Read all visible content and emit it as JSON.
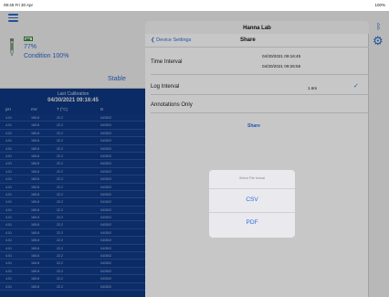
{
  "status_bar": {
    "time": "09:45 Fri 30 Apr",
    "battery": "100%"
  },
  "probe": {
    "battery_pct": "77%",
    "condition": "Condition 100%",
    "state": "Stable"
  },
  "calibration": {
    "label": "Last Calibration",
    "date": "04/30/2021 09:16:45"
  },
  "table": {
    "headers": [
      "pH",
      "mV",
      "T (°C)",
      "D"
    ],
    "rows": [
      [
        "4.01",
        "165.8",
        "22.2",
        "04/30/2"
      ],
      [
        "4.01",
        "165.8",
        "22.2",
        "04/30/2"
      ],
      [
        "4.01",
        "165.8",
        "22.2",
        "04/30/2"
      ],
      [
        "4.01",
        "165.8",
        "22.2",
        "04/30/2"
      ],
      [
        "4.01",
        "165.8",
        "22.2",
        "04/30/2"
      ],
      [
        "4.01",
        "165.8",
        "22.2",
        "04/30/2"
      ],
      [
        "4.01",
        "165.8",
        "22.2",
        "04/30/2"
      ],
      [
        "4.01",
        "165.8",
        "22.2",
        "04/30/2"
      ],
      [
        "4.01",
        "165.8",
        "22.2",
        "04/30/2"
      ],
      [
        "4.01",
        "165.8",
        "22.2",
        "04/30/2"
      ],
      [
        "4.01",
        "165.8",
        "22.2",
        "04/30/2"
      ],
      [
        "4.01",
        "165.8",
        "22.2",
        "04/30/2"
      ],
      [
        "4.01",
        "165.8",
        "22.2",
        "04/30/2"
      ],
      [
        "4.01",
        "165.8",
        "22.2",
        "04/30/2"
      ],
      [
        "4.01",
        "165.8",
        "22.2",
        "04/30/2"
      ],
      [
        "4.01",
        "165.8",
        "22.2",
        "04/30/2"
      ],
      [
        "4.01",
        "165.8",
        "22.2",
        "04/30/2"
      ],
      [
        "4.01",
        "165.8",
        "22.2",
        "04/30/2"
      ],
      [
        "4.01",
        "165.8",
        "22.2",
        "04/30/2"
      ],
      [
        "4.01",
        "165.8",
        "22.2",
        "04/30/2"
      ],
      [
        "4.01",
        "165.8",
        "22.2",
        "04/30/2"
      ],
      [
        "4.01",
        "165.8",
        "22.2",
        "04/30/2"
      ],
      [
        "4.01",
        "165.8",
        "22.2",
        "04/30/2"
      ]
    ]
  },
  "modal": {
    "title": "Hanna Lab",
    "back_label": "Device Settings",
    "nav_title": "Share",
    "time_interval_label": "Time Interval",
    "time_start": "04/30/2021 09:16:45",
    "time_end": "04/30/2021 09:26:55",
    "log_interval_label": "Log Interval",
    "log_interval_value": "1.6m",
    "annotations_label": "Annotations Only",
    "share_label": "Share"
  },
  "sheet": {
    "title": "Select File format",
    "options": [
      "CSV",
      "PDF"
    ]
  },
  "icons": {
    "menu": "menu-icon",
    "probe": "probe-icon",
    "battery": "battery-icon",
    "bluetooth": "bluetooth-icon",
    "settings": "gear-icon",
    "back": "chevron-left-icon",
    "check": "checkmark-icon"
  },
  "colors": {
    "accent": "#2e6fd8",
    "table_bg": "#0f3c8c"
  }
}
